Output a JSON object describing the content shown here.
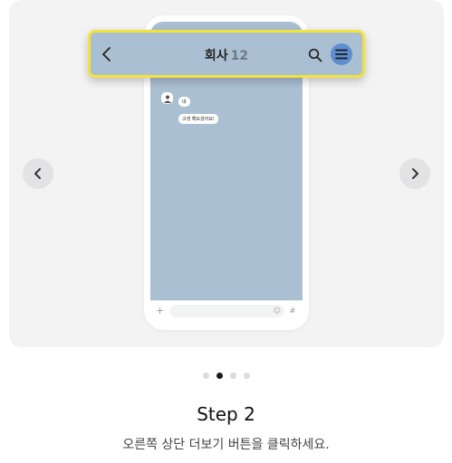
{
  "carousel": {
    "prev_icon": "chevron-left-icon",
    "next_icon": "chevron-right-icon",
    "active_index": 1,
    "total_slides": 4
  },
  "chat": {
    "room_name": "회사",
    "member_count": "12",
    "back_icon": "chevron-left-icon",
    "search_icon": "search-icon",
    "menu_icon": "hamburger-menu-icon",
    "highlight_color": "#f2e23d",
    "menu_button_color": "#5f8ed0",
    "background_color": "#abbfd3",
    "messages": [
      {
        "text": "네"
      },
      {
        "text": "고생 해요셨어요!"
      }
    ],
    "input_icons": [
      "plus-icon",
      "emoji-icon",
      "hash-icon"
    ]
  },
  "step": {
    "title": "Step 2",
    "description": "오른쪽 상단 더보기 버튼을 클릭하세요."
  }
}
